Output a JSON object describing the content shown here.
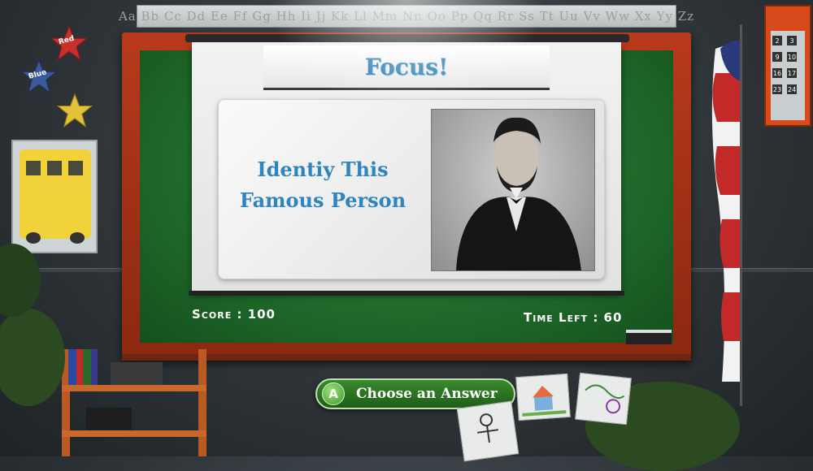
{
  "alphabet_strip": "Aa Bb Cc Dd Ee Ff Gg Hh Ii Jj Kk Ll Mm Nn Oo Pp Qq Rr Ss Tt Uu Vv Ww Xx Yy Zz",
  "stars": [
    {
      "label": "Red",
      "color": "#c8302c"
    },
    {
      "label": "Blue",
      "color": "#3a5a9a"
    },
    {
      "label": "",
      "color": "#e2c23a"
    }
  ],
  "calendar_numbers": [
    "2",
    "3",
    "9",
    "10",
    "16",
    "17",
    "23",
    "24"
  ],
  "game": {
    "title": "Focus!",
    "prompt_line1": "Identiy This",
    "prompt_line2": "Famous Person",
    "score_label": "Score : 100",
    "time_label": "Time Left : 60"
  },
  "action": {
    "button_glyph": "A",
    "label": "Choose an Answer"
  },
  "colors": {
    "title_blue": "#2f7fb4",
    "board_green": "#1f6a2a",
    "frame_red": "#a8341a",
    "button_green": "#2e7a24"
  }
}
